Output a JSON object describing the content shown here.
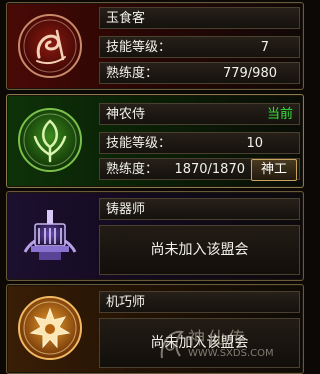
{
  "professions": [
    {
      "name": "玉食客",
      "level_label": "技能等级：",
      "level_value": "7",
      "proficiency_label": "熟练度：",
      "proficiency_value": "779/980",
      "emblem_icon": "cooking-emblem-icon",
      "theme_color": "#b8261c"
    },
    {
      "name": "神农侍",
      "badge": "当前",
      "level_label": "技能等级：",
      "level_value": "10",
      "proficiency_label": "熟练度：",
      "proficiency_value": "1870/1870",
      "button_label": "神工",
      "emblem_icon": "herbal-emblem-icon",
      "theme_color": "#2e7a1c"
    },
    {
      "name": "铸器师",
      "status_message": "尚未加入该盟会",
      "emblem_icon": "forge-emblem-icon",
      "theme_color": "#6a4ab8"
    },
    {
      "name": "机巧师",
      "status_message": "尚未加入该盟会",
      "emblem_icon": "mechanic-emblem-icon",
      "theme_color": "#d0781a"
    }
  ],
  "watermark": {
    "text": "神仙传",
    "url": "WWW.SXDS.COM"
  }
}
